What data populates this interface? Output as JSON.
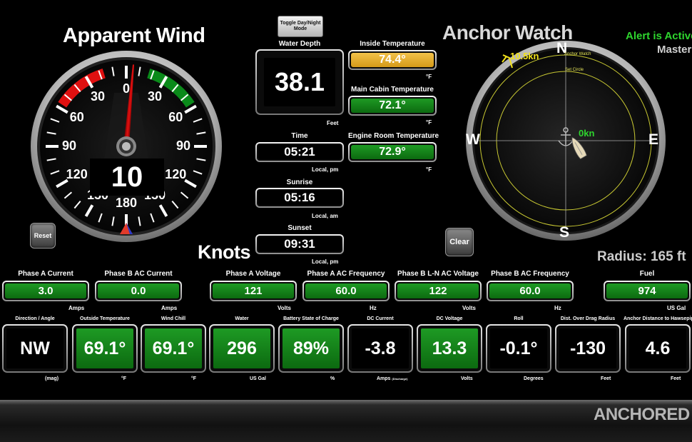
{
  "apparent_wind": {
    "title": "Apparent Wind",
    "speed": "10",
    "unit_label": "Knots",
    "angle_deg": 5,
    "dial_labels": [
      "0",
      "30",
      "60",
      "90",
      "120",
      "150",
      "180",
      "30",
      "60",
      "90",
      "120",
      "150"
    ],
    "reset_label": "Reset",
    "colors": {
      "port": "#e01010",
      "starboard": "#0a8a1a"
    }
  },
  "toggle_button": {
    "label": "Toggle Day/Night Mode"
  },
  "center": {
    "water_depth": {
      "label": "Water Depth",
      "value": "38.1",
      "unit": "Feet"
    },
    "time": {
      "label": "Time",
      "value": "05:21",
      "unit": "Local, pm"
    },
    "sunrise": {
      "label": "Sunrise",
      "value": "05:16",
      "unit": "Local, am"
    },
    "sunset": {
      "label": "Sunset",
      "value": "09:31",
      "unit": "Local, pm"
    },
    "inside_temp": {
      "label": "Inside Temperature",
      "value": "74.4°",
      "unit": "°F"
    },
    "main_cabin_temp": {
      "label": "Main Cabin Temperature",
      "value": "72.1°",
      "unit": "°F"
    },
    "engine_room_temp": {
      "label": "Engine Room Temperature",
      "value": "72.9°",
      "unit": "°F"
    }
  },
  "anchor_watch": {
    "title": "Anchor Watch",
    "alert": "Alert is Active",
    "role": "Master",
    "compass": {
      "n": "N",
      "s": "S",
      "e": "E",
      "w": "W"
    },
    "wind_speed": "10.5kn",
    "boat_speed": "0kn",
    "ring_outer_label": "Anchor Watch",
    "ring_inner_label": "Set Circle",
    "radius": "Radius: 165 ft",
    "clear_label": "Clear",
    "colors": {
      "alert": "#2ed52e",
      "ring": "#c8c832"
    }
  },
  "row1": [
    {
      "label": "Phase A Current",
      "value": "3.0",
      "unit": "Amps"
    },
    {
      "label": "Phase B AC Current",
      "value": "0.0",
      "unit": "Amps"
    },
    {
      "label": "Phase A Voltage",
      "value": "121",
      "unit": "Volts"
    },
    {
      "label": "Phase A AC Frequency",
      "value": "60.0",
      "unit": "Hz"
    },
    {
      "label": "Phase B L-N AC Voltage",
      "value": "122",
      "unit": "Volts"
    },
    {
      "label": "Phase B AC Frequency",
      "value": "60.0",
      "unit": "Hz"
    },
    {
      "label": "Fuel",
      "value": "974",
      "unit": "US Gal"
    }
  ],
  "row2": [
    {
      "label": "Direction / Angle",
      "value": "NW",
      "unit": "(mag)",
      "style": "black"
    },
    {
      "label": "Outside Temperature",
      "value": "69.1°",
      "unit": "°F",
      "style": "green"
    },
    {
      "label": "Wind Chill",
      "value": "69.1°",
      "unit": "°F",
      "style": "green"
    },
    {
      "label": "Water",
      "value": "296",
      "unit": "US Gal",
      "style": "green"
    },
    {
      "label": "Battery State of Charge",
      "value": "89%",
      "unit": "%",
      "style": "green"
    },
    {
      "label": "DC Current",
      "value": "-3.8",
      "unit": "Amps",
      "unit_small": "(Discharge)",
      "style": "black"
    },
    {
      "label": "DC Voltage",
      "value": "13.3",
      "unit": "Volts",
      "style": "green"
    },
    {
      "label": "Roll",
      "value": "-0.1°",
      "unit": "Degrees",
      "style": "black"
    },
    {
      "label": "Dist. Over Drag Radius",
      "value": "-130",
      "unit": "Feet",
      "style": "black"
    },
    {
      "label": "Anchor Distance to Hawsepipe",
      "value": "4.6",
      "unit": "Feet",
      "style": "black"
    }
  ],
  "footer": {
    "status": "ANCHORED"
  }
}
